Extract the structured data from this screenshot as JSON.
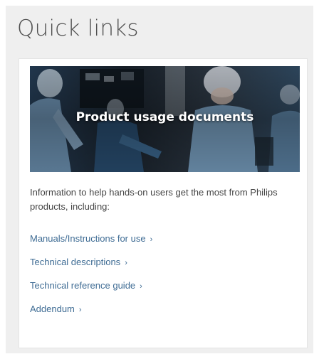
{
  "section": {
    "title": "Quick links"
  },
  "card": {
    "hero_title": "Product usage documents",
    "description": "Information to help hands-on users get the most from Philips products, including:",
    "links": [
      {
        "label": "Manuals/Instructions for use",
        "icon": "chevron-right-icon"
      },
      {
        "label": "Technical descriptions",
        "icon": "chevron-right-icon"
      },
      {
        "label": "Technical reference guide",
        "icon": "chevron-right-icon"
      },
      {
        "label": "Addendum",
        "icon": "chevron-right-icon"
      }
    ]
  },
  "colors": {
    "panel_background": "#efefef",
    "card_background": "#ffffff",
    "title_text": "#505050",
    "link": "#3f6c94",
    "body_text": "#454545"
  }
}
